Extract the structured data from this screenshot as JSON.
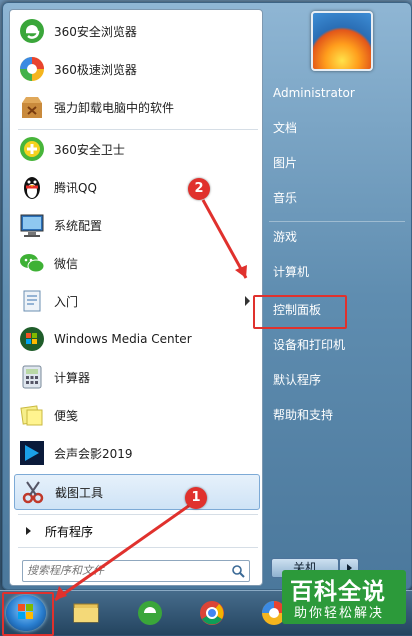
{
  "left_programs": [
    {
      "label": "360安全浏览器",
      "icon": "360-browser-icon"
    },
    {
      "label": "360极速浏览器",
      "icon": "360-speed-browser-icon"
    },
    {
      "label": "强力卸载电脑中的软件",
      "icon": "uninstall-box-icon"
    },
    {
      "label": "360安全卫士",
      "icon": "360-security-icon"
    },
    {
      "label": "腾讯QQ",
      "icon": "qq-penguin-icon"
    },
    {
      "label": "系统配置",
      "icon": "system-config-icon"
    },
    {
      "label": "微信",
      "icon": "wechat-icon"
    },
    {
      "label": "入门",
      "icon": "getting-started-icon"
    },
    {
      "label": "Windows Media Center",
      "icon": "media-center-icon"
    },
    {
      "label": "计算器",
      "icon": "calculator-icon"
    },
    {
      "label": "便笺",
      "icon": "sticky-notes-icon"
    },
    {
      "label": "会声会影2019",
      "icon": "video-studio-icon"
    },
    {
      "label": "截图工具",
      "icon": "snipping-tool-icon"
    }
  ],
  "all_programs": "所有程序",
  "search_placeholder": "搜索程序和文件",
  "right_items": [
    "Administrator",
    "文档",
    "图片",
    "音乐",
    "游戏",
    "计算机",
    "控制面板",
    "设备和打印机",
    "默认程序",
    "帮助和支持"
  ],
  "shutdown_label": "关机",
  "annotations": {
    "badge1": "1",
    "badge2": "2"
  },
  "colors": {
    "highlight": "#e0312d",
    "menu_blue": "#5f8db0"
  },
  "watermark": {
    "line1": "百科全说",
    "line2": "助你轻松解决"
  }
}
